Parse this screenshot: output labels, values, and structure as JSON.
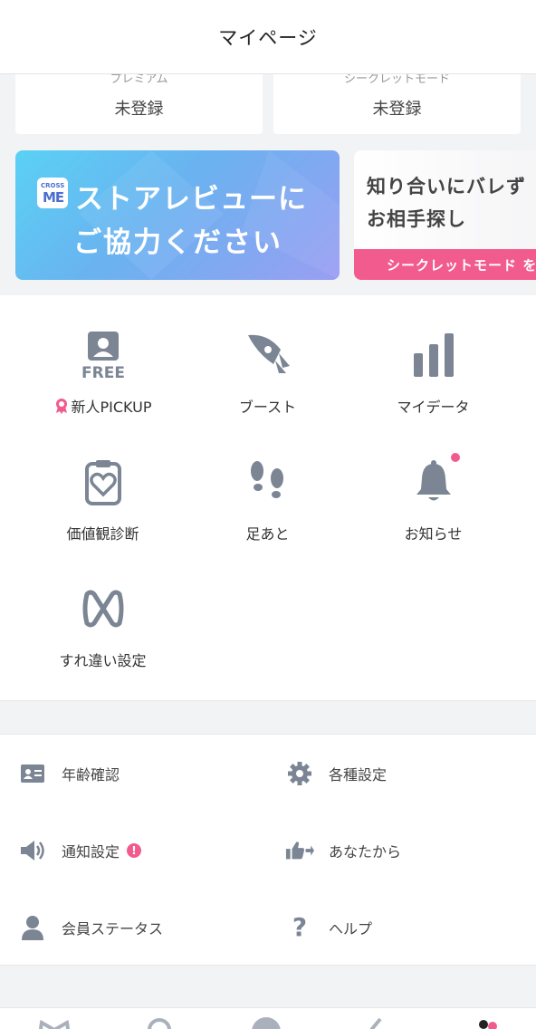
{
  "header": {
    "title": "マイページ"
  },
  "plans": [
    {
      "label": "プレミアム",
      "value": "未登録"
    },
    {
      "label": "シークレットモード",
      "value": "未登録"
    }
  ],
  "banners": {
    "review": {
      "logo_small": "CROSS",
      "logo_big": "ME",
      "line1": "ストアレビューに",
      "line2": "ご協力ください"
    },
    "secret": {
      "line1": "知り合いにバレず",
      "line2": "お相手探し",
      "strip": "シークレットモード を"
    }
  },
  "features": [
    {
      "label": "新人PICKUP",
      "icon": "free-profile-icon",
      "icon_text": "FREE",
      "prefix_icon": "award-ribbon-icon"
    },
    {
      "label": "ブースト",
      "icon": "rocket-icon"
    },
    {
      "label": "マイデータ",
      "icon": "bar-chart-icon"
    },
    {
      "label": "価値観診断",
      "icon": "clipboard-heart-icon"
    },
    {
      "label": "足あと",
      "icon": "footprints-icon"
    },
    {
      "label": "お知らせ",
      "icon": "bell-icon"
    },
    {
      "label": "すれ違い設定",
      "icon": "crossme-logo-icon"
    }
  ],
  "settings": [
    {
      "label": "年齢確認",
      "icon": "id-card-icon"
    },
    {
      "label": "各種設定",
      "icon": "gear-icon"
    },
    {
      "label": "通知設定",
      "icon": "speaker-icon",
      "alert": "!"
    },
    {
      "label": "あなたから",
      "icon": "thumbs-up-arrow-icon"
    },
    {
      "label": "会員ステータス",
      "icon": "user-icon"
    },
    {
      "label": "ヘルプ",
      "icon": "help-question-icon"
    }
  ],
  "colors": {
    "accent_pink": "#f25b8d",
    "icon_gray": "#7b8593",
    "banner_blue": "#5ad1f4",
    "banner_purple": "#9a9ef3"
  }
}
